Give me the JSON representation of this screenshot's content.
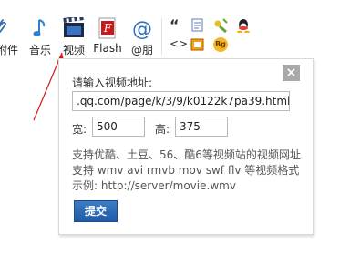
{
  "toolbar": {
    "items": [
      {
        "label": "附件",
        "icon": "attachment-icon"
      },
      {
        "label": "音乐",
        "icon": "music-icon"
      },
      {
        "label": "视频",
        "icon": "video-icon"
      },
      {
        "label": "Flash",
        "icon": "flash-icon"
      },
      {
        "label": "@朋",
        "icon": "at-icon"
      }
    ],
    "small_icons": [
      "quote-icon",
      "doc-icon",
      "edit-icon",
      "qq-icon",
      "code-icon",
      "image-icon",
      "bg-icon"
    ],
    "small_text": {
      "quote": "“",
      "code": "<>",
      "bg": "Bg"
    }
  },
  "dialog": {
    "prompt": "请输入视频地址:",
    "url_value": ".qq.com/page/k/3/9/k0122k7pa39.html",
    "width_label": "宽:",
    "width_value": "500",
    "height_label": "高:",
    "height_value": "375",
    "note_sites": "支持优酷、土豆、56、酷6等视频站的视频网址",
    "note_formats": "支持 wmv avi rmvb mov swf flv 等视频格式",
    "note_example": "示例: http://server/movie.wmv",
    "submit_label": "提交",
    "close_label": "×"
  },
  "colors": {
    "accent": "#1f5aa6",
    "close": "#a9a9a9",
    "arrow": "#d01818"
  }
}
